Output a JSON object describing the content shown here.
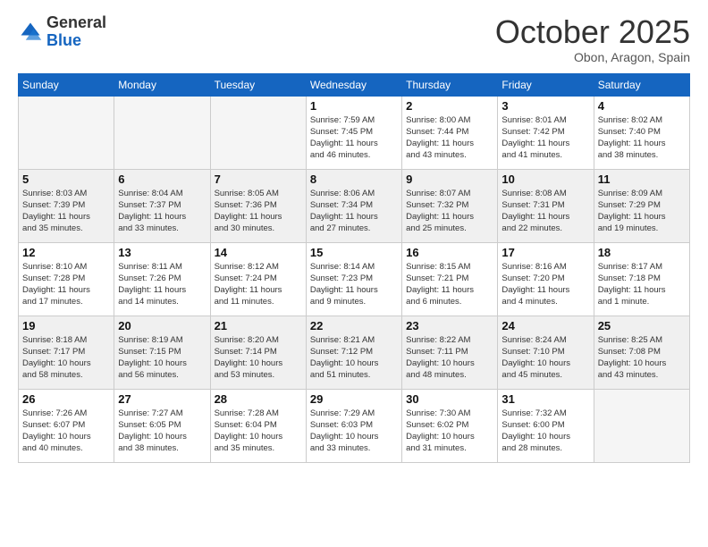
{
  "header": {
    "logo_general": "General",
    "logo_blue": "Blue",
    "month": "October 2025",
    "location": "Obon, Aragon, Spain"
  },
  "days_of_week": [
    "Sunday",
    "Monday",
    "Tuesday",
    "Wednesday",
    "Thursday",
    "Friday",
    "Saturday"
  ],
  "weeks": [
    [
      {
        "day": "",
        "info": ""
      },
      {
        "day": "",
        "info": ""
      },
      {
        "day": "",
        "info": ""
      },
      {
        "day": "1",
        "info": "Sunrise: 7:59 AM\nSunset: 7:45 PM\nDaylight: 11 hours\nand 46 minutes."
      },
      {
        "day": "2",
        "info": "Sunrise: 8:00 AM\nSunset: 7:44 PM\nDaylight: 11 hours\nand 43 minutes."
      },
      {
        "day": "3",
        "info": "Sunrise: 8:01 AM\nSunset: 7:42 PM\nDaylight: 11 hours\nand 41 minutes."
      },
      {
        "day": "4",
        "info": "Sunrise: 8:02 AM\nSunset: 7:40 PM\nDaylight: 11 hours\nand 38 minutes."
      }
    ],
    [
      {
        "day": "5",
        "info": "Sunrise: 8:03 AM\nSunset: 7:39 PM\nDaylight: 11 hours\nand 35 minutes."
      },
      {
        "day": "6",
        "info": "Sunrise: 8:04 AM\nSunset: 7:37 PM\nDaylight: 11 hours\nand 33 minutes."
      },
      {
        "day": "7",
        "info": "Sunrise: 8:05 AM\nSunset: 7:36 PM\nDaylight: 11 hours\nand 30 minutes."
      },
      {
        "day": "8",
        "info": "Sunrise: 8:06 AM\nSunset: 7:34 PM\nDaylight: 11 hours\nand 27 minutes."
      },
      {
        "day": "9",
        "info": "Sunrise: 8:07 AM\nSunset: 7:32 PM\nDaylight: 11 hours\nand 25 minutes."
      },
      {
        "day": "10",
        "info": "Sunrise: 8:08 AM\nSunset: 7:31 PM\nDaylight: 11 hours\nand 22 minutes."
      },
      {
        "day": "11",
        "info": "Sunrise: 8:09 AM\nSunset: 7:29 PM\nDaylight: 11 hours\nand 19 minutes."
      }
    ],
    [
      {
        "day": "12",
        "info": "Sunrise: 8:10 AM\nSunset: 7:28 PM\nDaylight: 11 hours\nand 17 minutes."
      },
      {
        "day": "13",
        "info": "Sunrise: 8:11 AM\nSunset: 7:26 PM\nDaylight: 11 hours\nand 14 minutes."
      },
      {
        "day": "14",
        "info": "Sunrise: 8:12 AM\nSunset: 7:24 PM\nDaylight: 11 hours\nand 11 minutes."
      },
      {
        "day": "15",
        "info": "Sunrise: 8:14 AM\nSunset: 7:23 PM\nDaylight: 11 hours\nand 9 minutes."
      },
      {
        "day": "16",
        "info": "Sunrise: 8:15 AM\nSunset: 7:21 PM\nDaylight: 11 hours\nand 6 minutes."
      },
      {
        "day": "17",
        "info": "Sunrise: 8:16 AM\nSunset: 7:20 PM\nDaylight: 11 hours\nand 4 minutes."
      },
      {
        "day": "18",
        "info": "Sunrise: 8:17 AM\nSunset: 7:18 PM\nDaylight: 11 hours\nand 1 minute."
      }
    ],
    [
      {
        "day": "19",
        "info": "Sunrise: 8:18 AM\nSunset: 7:17 PM\nDaylight: 10 hours\nand 58 minutes."
      },
      {
        "day": "20",
        "info": "Sunrise: 8:19 AM\nSunset: 7:15 PM\nDaylight: 10 hours\nand 56 minutes."
      },
      {
        "day": "21",
        "info": "Sunrise: 8:20 AM\nSunset: 7:14 PM\nDaylight: 10 hours\nand 53 minutes."
      },
      {
        "day": "22",
        "info": "Sunrise: 8:21 AM\nSunset: 7:12 PM\nDaylight: 10 hours\nand 51 minutes."
      },
      {
        "day": "23",
        "info": "Sunrise: 8:22 AM\nSunset: 7:11 PM\nDaylight: 10 hours\nand 48 minutes."
      },
      {
        "day": "24",
        "info": "Sunrise: 8:24 AM\nSunset: 7:10 PM\nDaylight: 10 hours\nand 45 minutes."
      },
      {
        "day": "25",
        "info": "Sunrise: 8:25 AM\nSunset: 7:08 PM\nDaylight: 10 hours\nand 43 minutes."
      }
    ],
    [
      {
        "day": "26",
        "info": "Sunrise: 7:26 AM\nSunset: 6:07 PM\nDaylight: 10 hours\nand 40 minutes."
      },
      {
        "day": "27",
        "info": "Sunrise: 7:27 AM\nSunset: 6:05 PM\nDaylight: 10 hours\nand 38 minutes."
      },
      {
        "day": "28",
        "info": "Sunrise: 7:28 AM\nSunset: 6:04 PM\nDaylight: 10 hours\nand 35 minutes."
      },
      {
        "day": "29",
        "info": "Sunrise: 7:29 AM\nSunset: 6:03 PM\nDaylight: 10 hours\nand 33 minutes."
      },
      {
        "day": "30",
        "info": "Sunrise: 7:30 AM\nSunset: 6:02 PM\nDaylight: 10 hours\nand 31 minutes."
      },
      {
        "day": "31",
        "info": "Sunrise: 7:32 AM\nSunset: 6:00 PM\nDaylight: 10 hours\nand 28 minutes."
      },
      {
        "day": "",
        "info": ""
      }
    ]
  ]
}
